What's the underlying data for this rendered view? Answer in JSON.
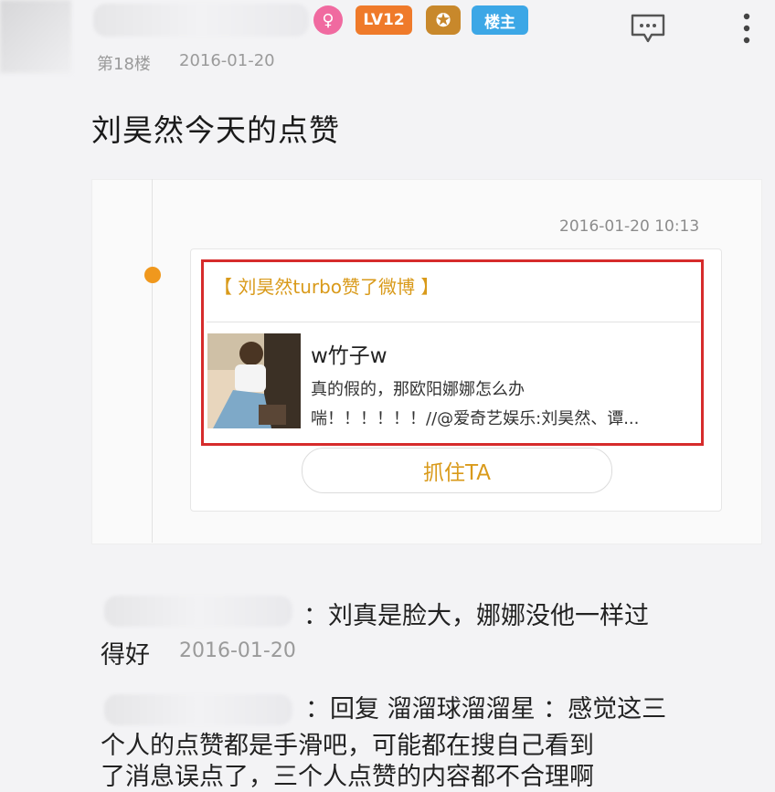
{
  "post": {
    "badges": {
      "female": "♀",
      "level": "LV12",
      "medal": "✪",
      "louzhu": "楼主"
    },
    "floor": "第18楼",
    "date": "2016-01-20",
    "title": "刘昊然今天的点赞"
  },
  "card": {
    "time": "2016-01-20 10:13",
    "liked_label": "【 刘昊然turbo赞了微博 】",
    "author": "w竹子w",
    "excerpt_line1": "真的假的，那欧阳娜娜怎么办",
    "excerpt_line2": "喘！！！！！！//@爱奇艺娱乐:刘昊然、谭...",
    "button_label": "抓住TA"
  },
  "replies": [
    {
      "text_line1": "：刘真是脸大，娜娜没他一样过",
      "text_line2": "得好",
      "date": "2016-01-20"
    },
    {
      "text_line1": "：回复 溜溜球溜溜星 ：感觉这三",
      "text_line2": "个人的点赞都是手滑吧，可能都在搜自己看到",
      "text_line3": "了消息误点了，三个人点赞的内容都不合理啊"
    }
  ],
  "icons": {
    "message": "comment-bubble-icon",
    "more": "more-vertical-icon"
  },
  "colors": {
    "accent_orange": "#f0981d",
    "link_gold": "#d99a1a",
    "highlight_red": "#d62b2b",
    "louzhu_blue": "#3ca7e6"
  }
}
